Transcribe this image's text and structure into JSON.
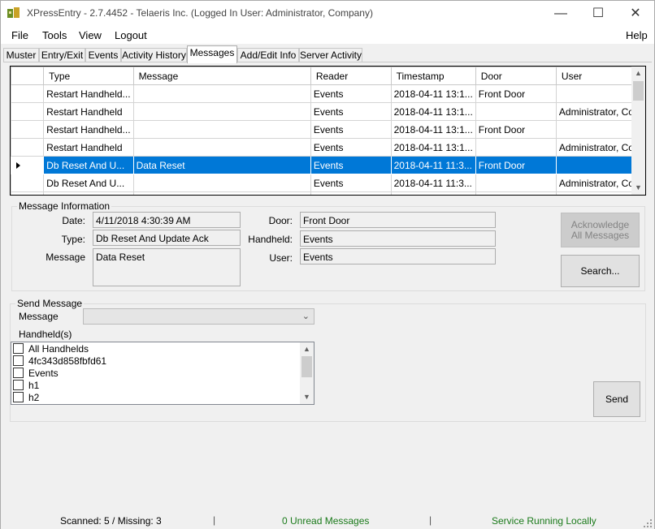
{
  "window": {
    "title": "XPressEntry - 2.7.4452 - Telaeris Inc. (Logged In User: Administrator, Company)",
    "minimize": "—",
    "maximize": "☐",
    "close": "✕"
  },
  "menu": {
    "file": "File",
    "tools": "Tools",
    "view": "View",
    "logout": "Logout",
    "help": "Help"
  },
  "tabs": [
    {
      "label": "Muster"
    },
    {
      "label": "Entry/Exit"
    },
    {
      "label": "Events"
    },
    {
      "label": "Activity History"
    },
    {
      "label": "Messages"
    },
    {
      "label": "Add/Edit Info"
    },
    {
      "label": "Server Activity"
    }
  ],
  "active_tab": "Messages",
  "grid": {
    "columns": [
      "Type",
      "Message",
      "Reader",
      "Timestamp",
      "Door",
      "User"
    ],
    "rows": [
      [
        "Restart Handheld...",
        "",
        "Events",
        "2018-04-11 13:1...",
        "Front Door",
        ""
      ],
      [
        "Restart Handheld",
        "",
        "Events",
        "2018-04-11 13:1...",
        "",
        "Administrator, Co..."
      ],
      [
        "Restart Handheld...",
        "",
        "Events",
        "2018-04-11 13:1...",
        "Front Door",
        ""
      ],
      [
        "Restart Handheld",
        "",
        "Events",
        "2018-04-11 13:1...",
        "",
        "Administrator, Co..."
      ],
      [
        "Db Reset And U...",
        "Data Reset",
        "Events",
        "2018-04-11 11:3...",
        "Front Door",
        ""
      ],
      [
        "Db Reset And U...",
        "",
        "Events",
        "2018-04-11 11:3...",
        "",
        "Administrator, Co..."
      ],
      [
        "",
        "",
        "",
        "",
        "",
        ""
      ]
    ],
    "selected_row": 4
  },
  "message_info": {
    "title": "Message Information",
    "date_label": "Date:",
    "date": "4/11/2018 4:30:39 AM",
    "type_label": "Type:",
    "type": "Db Reset And Update Ack",
    "message_label": "Message",
    "message": "Data Reset",
    "door_label": "Door:",
    "door": "Front Door",
    "handheld_label": "Handheld:",
    "handheld": "Events",
    "user_label": "User:",
    "user": "Events",
    "ack_line1": "Acknowledge",
    "ack_line2": "All Messages",
    "search": "Search..."
  },
  "send_message": {
    "title": "Send Message",
    "message_label": "Message",
    "message_value": "",
    "handhelds_label": "Handheld(s)",
    "handhelds": [
      "All Handhelds",
      "4fc343d858fbfd61",
      "Events",
      "h1",
      "h2"
    ],
    "send": "Send"
  },
  "status": {
    "scanned": "Scanned: 5 / Missing: 3",
    "unread": "0 Unread Messages",
    "service": "Service Running Locally",
    "sep": "|"
  },
  "colors": {
    "selection": "#0078d7",
    "status_green": "#1a7a1a"
  }
}
